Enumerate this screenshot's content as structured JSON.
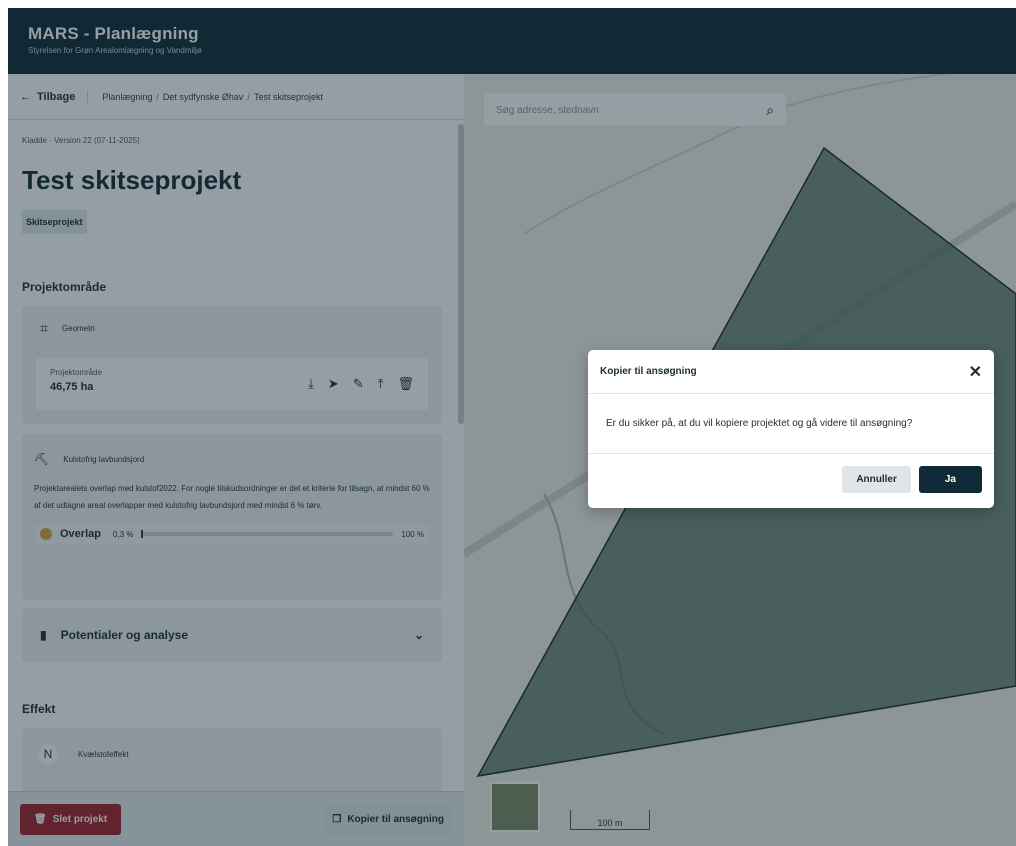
{
  "header": {
    "title": "MARS - Planlægning",
    "subtitle": "Styrelsen for Grøn Arealomlægning og Vandmiljø"
  },
  "breadcrumb": {
    "back": "Tilbage",
    "items": [
      "Planlægning",
      "Det sydfynske Øhav",
      "Test skitseprojekt"
    ],
    "separator": "/"
  },
  "project": {
    "draft_line": "Kladde · Version 22 (07-11-2025)",
    "title": "Test skitseprojekt",
    "type_badge": "Skitseprojekt"
  },
  "projektomraade": {
    "heading": "Projektområde",
    "geometry_label": "Geometri",
    "area_label": "Projektområde",
    "area_value": "46,75 ha",
    "tool_icons": [
      "download-icon",
      "pointer-icon",
      "edit-icon",
      "upload-icon",
      "trash-icon"
    ]
  },
  "soil": {
    "label": "Kulstofrig lavbundsjord",
    "text": "Projektarealets overlap med kulstof2022. For nogle tilskudsordninger er det et kriterie for tilsagn, at mindst 60 % af det udtagne areal overlapper med kulstofrig lavbundsjord med mindst 6 % tørv.",
    "overlap_label": "Overlap",
    "overlap_value": "0,3 %",
    "overlap_fraction": 0.003,
    "overlap_max": "100 %",
    "status_color": "#d9a33a"
  },
  "potential": {
    "label": "Potentialer og analyse"
  },
  "effekt": {
    "heading": "Effekt",
    "nitrogen_badge": "N",
    "label": "Kvælstofeffekt"
  },
  "footer": {
    "delete": "Slet projekt",
    "copy": "Kopier til ansøgning"
  },
  "map": {
    "search_placeholder": "Søg adresse, stednavn",
    "scale": "100 m"
  },
  "modal": {
    "title": "Kopier til ansøgning",
    "body": "Er du sikker på, at du vil kopiere projektet og gå videre til ansøgning?",
    "cancel": "Annuller",
    "confirm": "Ja"
  },
  "colors": {
    "header": "#0f2a36",
    "danger": "#a3202c",
    "primary": "#0f2a36"
  }
}
